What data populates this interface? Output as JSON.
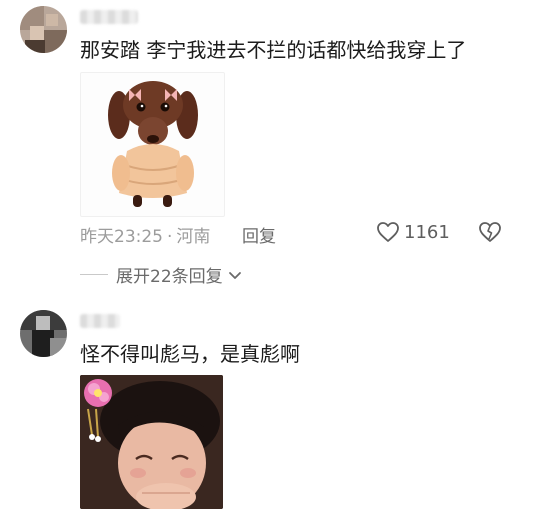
{
  "comments": [
    {
      "text": "那安踏 李宁我进去不拦的话都快给我穿上了",
      "time": "昨天23:25",
      "location": "河南",
      "reply_label": "回复",
      "likes": "1161",
      "expand_label": "展开22条回复"
    },
    {
      "text": "怪不得叫彪马，是真彪啊"
    }
  ],
  "icons": {
    "like": "heart-icon",
    "dislike": "broken-heart-icon",
    "expand": "chevron-down-icon"
  }
}
